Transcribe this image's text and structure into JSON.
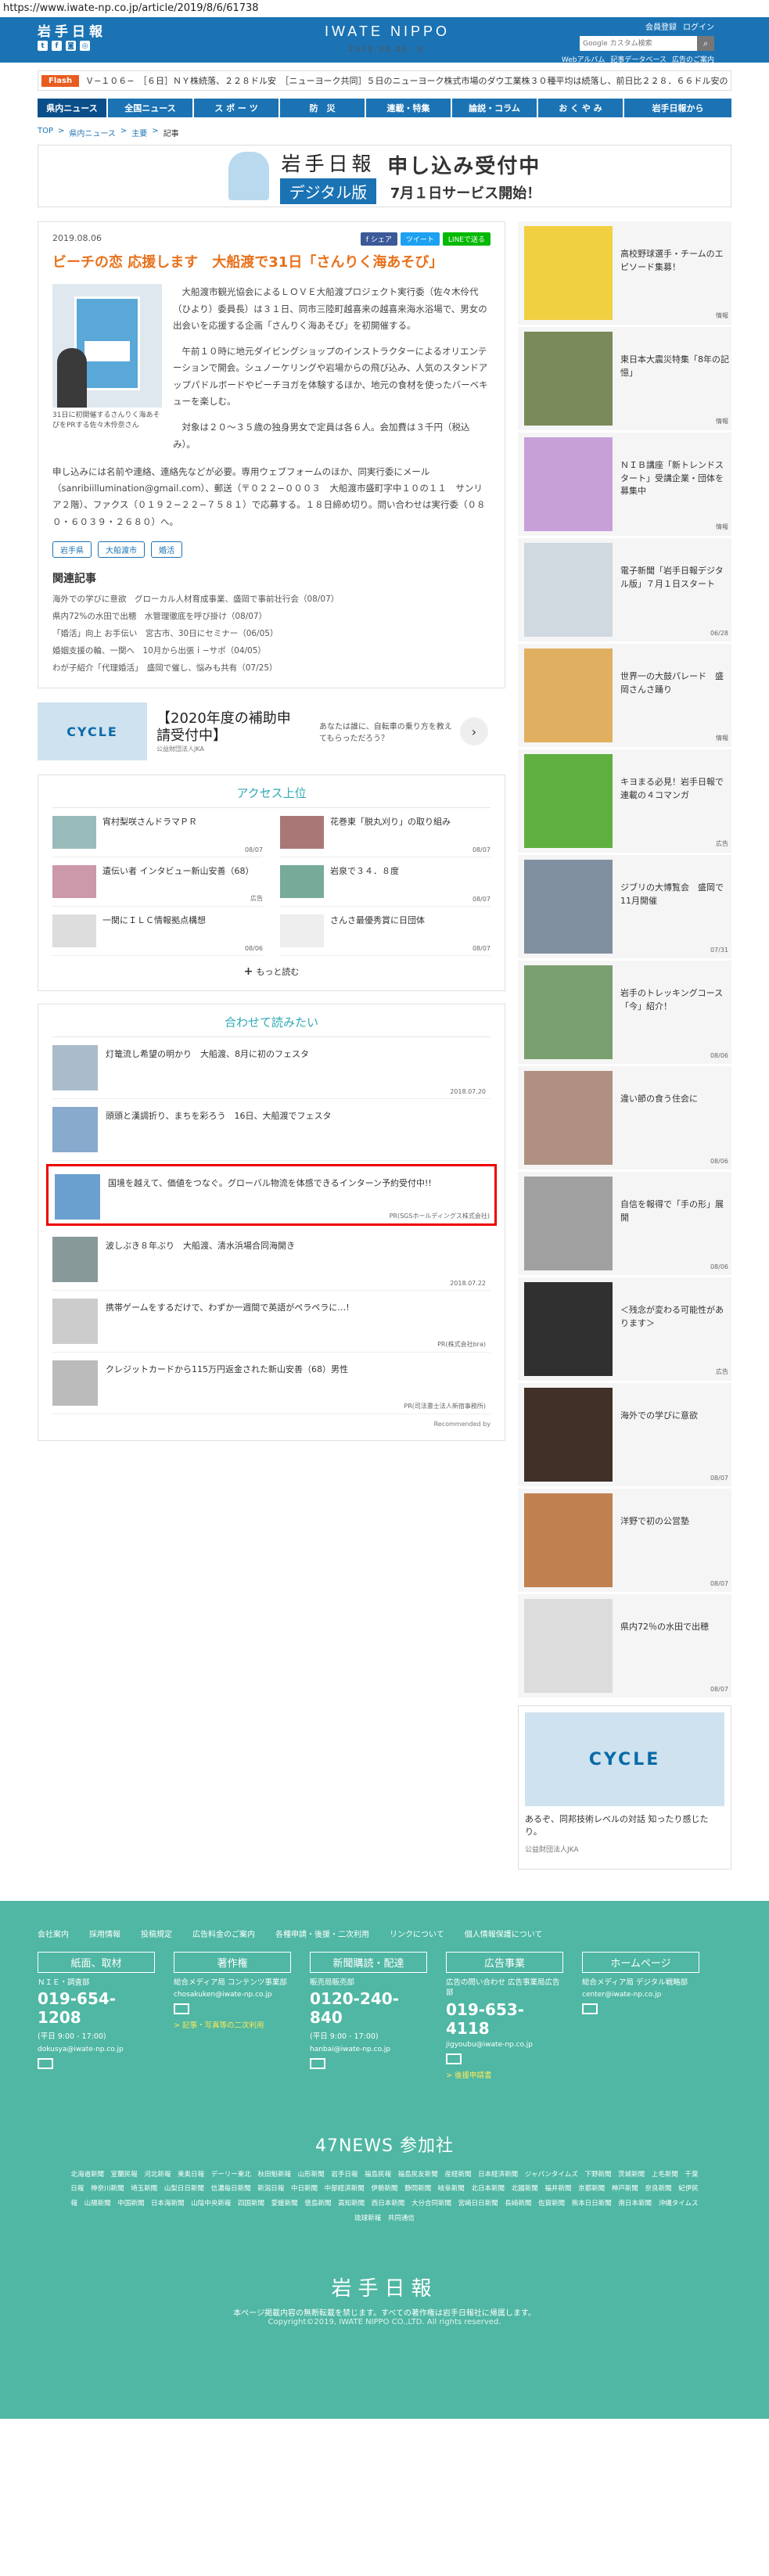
{
  "url": "https://www.iwate-np.co.jp/article/2019/8/6/61738",
  "header": {
    "logo": "岩手日報",
    "brand": "IWATE NIPPO",
    "date": "2019.08.06. 火",
    "member_links": [
      "会員登録",
      "ログイン"
    ],
    "search_placeholder": "Google カスタム検索",
    "sub_links": [
      "Webアルバム",
      "記事データベース",
      "広告のご案内"
    ]
  },
  "flash": {
    "label": "Flash",
    "text": "Ｖ−１０６−　［６日］ＮＹ株続落、２２８ドル安　［ニューヨーク共同］５日のニューヨーク株式市場のダウ工業株３０種平均は続落し、前日比２２８．６６ドル安の"
  },
  "nav": [
    "県内ニュース",
    "全国ニュース",
    "ス ポ ー ツ",
    "防　災",
    "連載・特集",
    "論説・コラム",
    "お く や み",
    "岩手日報から"
  ],
  "breadcrumb": [
    "TOP",
    "県内ニュース",
    "主要",
    "記事"
  ],
  "banner": {
    "brand_top": "岩手日報",
    "brand_bottom": "デジタル版",
    "headline": "申し込み受付中",
    "sub": "7月１日サービス開始！"
  },
  "article": {
    "date": "2019.08.06",
    "share": [
      "f シェア",
      "ツイート",
      "LINEで送る"
    ],
    "title": "ビーチの恋 応援します　大船渡で31日「さんりく海あそび」",
    "caption": "31日に初開催するさんりく海あそびをPRする佐々木伶奈さん",
    "paragraphs": [
      "大船渡市観光協会によるＬＯＶＥ大船渡プロジェクト実行委（佐々木伶代（ひより）委員長）は３１日、同市三陸町越喜来の越喜来海水浴場で、男女の出会いを応援する企画「さんりく海あそび」を初開催する。",
      "午前１０時に地元ダイビングショップのインストラクターによるオリエンテーションで開会。シュノーケリングや岩場からの飛び込み、人気のスタンドアップパドルボードやビーチヨガを体験するほか、地元の食材を使ったバーベキューを楽しむ。",
      "対象は２０〜３５歳の独身男女で定員は各６人。会加費は３千円（税込み）。"
    ],
    "paragraph_full": "申し込みには名前や連絡、連絡先などが必要。専用ウェブフォームのほか、同実行委にメール（sanribiillumination@gmail.com）、郵送（〒０２２−０００３　大船渡市盛町字中１０の１１　サンリア２階）、ファクス（０１９２−２２−７５８１）で応募する。１８日締め切り。問い合わせは実行委（０８０・６０３９・２６８０）へ。",
    "tags": [
      "岩手県",
      "大船渡市",
      "婚活"
    ]
  },
  "related": {
    "title": "関連記事",
    "items": [
      "海外での学びに意欲　グローカル人材育成事業、盛岡で事前壮行会（08/07）",
      "県内72%の水田で出穂　水管理徹底を呼び掛け（08/07）",
      "「婚活」向上 お手伝い　宮古市、30日にセミナー（06/05）",
      "婚姻支援の輪、一関へ　10月から出張ｉ−サポ（04/05）",
      "わが子紹介「代理婚活」　盛岡で催し、悩みも共有（07/25）"
    ]
  },
  "ad": {
    "logo": "CYCLE",
    "title": "【2020年度の補助申請受付中】",
    "sponsor": "公益財団法人JKA",
    "desc": "あなたは誰に、自転車の乗り方を教えてもらっただろう？"
  },
  "ranking": {
    "title": "アクセス上位",
    "items": [
      {
        "title": "宵村梨咲さんドラマＰＲ",
        "date": "08/07"
      },
      {
        "title": "花巻東「脱丸刈り」の取り組み",
        "date": "08/07"
      },
      {
        "title": "遺伝い者 インタビュー新山安善（68）",
        "date": "広告"
      },
      {
        "title": "岩泉で３４．８度",
        "date": "08/07"
      },
      {
        "title": "一関にＩＬＣ情報拠点構想",
        "date": "08/06"
      },
      {
        "title": "さんさ最優秀賞に日団体",
        "date": "08/07"
      }
    ],
    "more": "もっと読む"
  },
  "recommend": {
    "title": "合わせて読みたい",
    "items": [
      {
        "title": "灯篭流し希望の明かり　大船渡、8月に初のフェスタ",
        "date": "2018.07.20"
      },
      {
        "title": "頭頭と漢調折り、まちを彩ろう　16日、大船渡でフェスタ",
        "date": ""
      },
      {
        "title": "国境を越えて、価値をつなぐ。グローバル物流を体感できるインターン予約受付中!!",
        "date": "PR(SGSホールディングス株式会社)"
      },
      {
        "title": "波しぶき８年ぶり　大船渡、清水浜場合同海開き",
        "date": "2018.07.22"
      },
      {
        "title": "携帯ゲームをするだけで、わずか一週間で英語がペラペラに…!",
        "date": "PR(株式会社bra)"
      },
      {
        "title": "クレジットカードから115万円返金された新山安善（68）男性",
        "date": "PR(司法書士法人新宿事務所)"
      }
    ],
    "footer": "Recommended by"
  },
  "sidebar": [
    {
      "title": "高校野球選手・チームのエピソード集募！",
      "date": "情報"
    },
    {
      "title": "東日本大震災特集「8年の記憶」",
      "date": "情報"
    },
    {
      "title": "ＮＩＢ講座「新トレンドスタート」受講企業・団体を募集中",
      "date": "情報"
    },
    {
      "title": "電子新聞「岩手日報デジタル版」７月１日スタート",
      "date": "06/28"
    },
    {
      "title": "世界一の大鼓パレード　盛岡さんさ踊り",
      "date": "情報"
    },
    {
      "title": "キヨまる必見！岩手日報で連載の４コマンガ",
      "date": "広告"
    },
    {
      "title": "ジブリの大博覧会　盛岡で11月開催",
      "date": "07/31"
    },
    {
      "title": "岩手のトレッキングコース「今」紹介！",
      "date": "08/06"
    },
    {
      "title": "違い節の食う住会に",
      "date": "08/06"
    },
    {
      "title": "自信を報得で「手の形」展開",
      "date": "08/06"
    },
    {
      "title": "＜残念が変わる可能性があります＞",
      "date": "広告"
    },
    {
      "title": "海外での学びに意欲",
      "date": "08/07"
    },
    {
      "title": "洋野で初の公営塾",
      "date": "08/07"
    },
    {
      "title": "県内72％の水田で出穂",
      "date": "08/07"
    }
  ],
  "side_ad": {
    "logo": "CYCLE",
    "text": "あるぞ、同邦技術レベルの対話 知ったり感じたり。",
    "sponsor": "公益財団法人JKA"
  },
  "footer": {
    "links": [
      "会社案内",
      "採用情報",
      "投稿規定",
      "広告料金のご案内",
      "各種申請・後援・二次利用",
      "リンクについて",
      "個人情報保護について"
    ],
    "cols": [
      {
        "head": "紙面、取材",
        "sub": "ＮＩＥ・調査部",
        "phone": "019-654-1208",
        "hours": "(平日 9:00 - 17:00)",
        "mail": "dokusya@iwate-np.co.jp",
        "link": ""
      },
      {
        "head": "著作権",
        "sub": "総合メディア局 コンテンツ事業部",
        "phone": "",
        "hours": "",
        "mail": "chosakuken@iwate-np.co.jp",
        "link": "> 記事・写真等の二次利用"
      },
      {
        "head": "新聞購読・配達",
        "sub": "販売局販売部",
        "phone": "0120-240-840",
        "hours": "(平日 9:00 - 17:00)",
        "mail": "hanbai@iwate-np.co.jp",
        "link": ""
      },
      {
        "head": "広告事業",
        "sub": "広告の問い合わせ 広告事業局広告部",
        "phone": "019-653-4118",
        "hours": "",
        "mail": "jigyoubu@iwate-np.co.jp",
        "link": "> 後援申請書"
      },
      {
        "head": "ホームページ",
        "sub": "総合メディア局 デジタル戦略部",
        "phone": "",
        "hours": "",
        "mail": "center@iwate-np.co.jp",
        "link": ""
      }
    ],
    "news47_title": "47NEWS 参加社",
    "news47": "北海道新聞 室蘭民報 河北新報 東奥日報 デーリー東北 秋田魁新報 山形新聞 岩手日報 福島民報 福島民友新聞 産経新聞 日本経済新聞 ジャパンタイムズ 下野新聞 茨城新聞 上毛新聞 千葉日報 神奈川新聞 埼玉新聞 山梨日日新聞 信濃毎日新聞 新潟日報 中日新聞 中部経済新聞 伊勢新聞 静岡新聞 岐阜新聞 北日本新聞 北國新聞 福井新聞 京都新聞 神戸新聞 奈良新聞 紀伊民報 山陽新聞 中国新聞 日本海新聞 山陰中央新報 四国新聞 愛媛新聞 徳島新聞 高知新聞 西日本新聞 大分合同新聞 宮崎日日新聞 長崎新聞 佐賀新聞 熊本日日新聞 南日本新聞 沖縄タイムス 琉球新報 共同通信",
    "logo": "岩手日報",
    "copy1": "本ページ掲載内容の無断転載を禁じます。すべての著作権は岩手日報社に帰属します。",
    "copy2": "Copyright©2019, IWATE NIPPO CO.,LTD. All rights reserved."
  }
}
